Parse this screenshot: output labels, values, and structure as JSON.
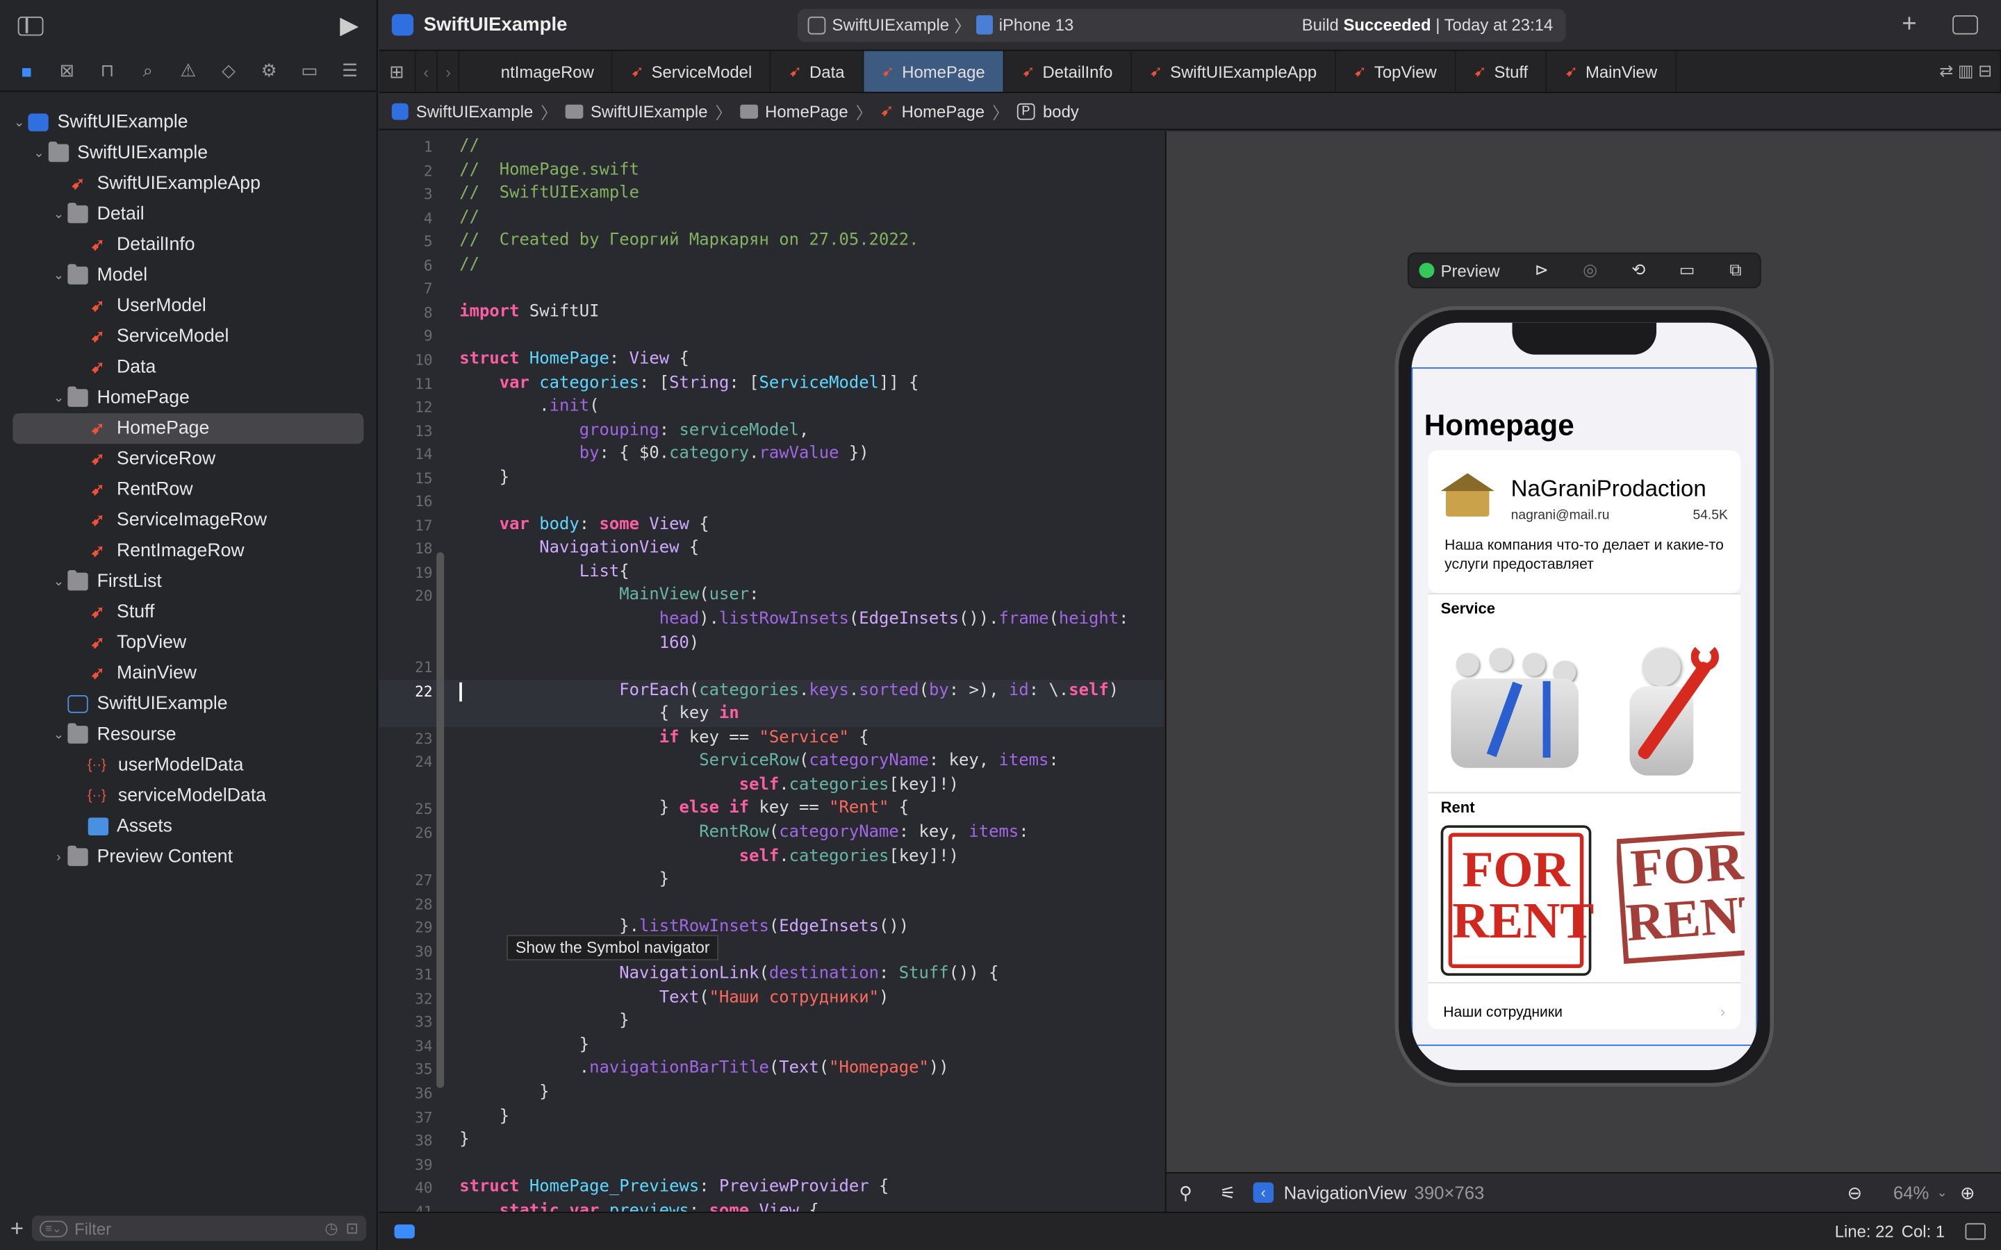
{
  "toolbar": {
    "project": "SwiftUIExample",
    "scheme": "SwiftUIExample",
    "device": "iPhone 13",
    "build_status_prefix": "Build ",
    "build_status": "Succeeded",
    "build_time": " | Today at 23:14"
  },
  "tabs": [
    "ntImageRow",
    "ServiceModel",
    "Data",
    "HomePage",
    "DetailInfo",
    "SwiftUIExampleApp",
    "TopView",
    "Stuff",
    "MainView"
  ],
  "active_tab": "HomePage",
  "breadcrumb": [
    "SwiftUIExample",
    "SwiftUIExample",
    "HomePage",
    "HomePage",
    "body"
  ],
  "navigator": [
    {
      "label": "SwiftUIExample",
      "kind": "project",
      "depth": 0,
      "open": true
    },
    {
      "label": "SwiftUIExample",
      "kind": "folder",
      "depth": 1,
      "open": true
    },
    {
      "label": "SwiftUIExampleApp",
      "kind": "swift",
      "depth": 2
    },
    {
      "label": "Detail",
      "kind": "folder",
      "depth": 2,
      "open": true
    },
    {
      "label": "DetailInfo",
      "kind": "swift",
      "depth": 3
    },
    {
      "label": "Model",
      "kind": "folder",
      "depth": 2,
      "open": true
    },
    {
      "label": "UserModel",
      "kind": "swift",
      "depth": 3
    },
    {
      "label": "ServiceModel",
      "kind": "swift",
      "depth": 3
    },
    {
      "label": "Data",
      "kind": "swift",
      "depth": 3
    },
    {
      "label": "HomePage",
      "kind": "folder",
      "depth": 2,
      "open": true
    },
    {
      "label": "HomePage",
      "kind": "swift",
      "depth": 3,
      "selected": true
    },
    {
      "label": "ServiceRow",
      "kind": "swift",
      "depth": 3
    },
    {
      "label": "RentRow",
      "kind": "swift",
      "depth": 3
    },
    {
      "label": "ServiceImageRow",
      "kind": "swift",
      "depth": 3
    },
    {
      "label": "RentImageRow",
      "kind": "swift",
      "depth": 3
    },
    {
      "label": "FirstList",
      "kind": "folder",
      "depth": 2,
      "open": true
    },
    {
      "label": "Stuff",
      "kind": "swift",
      "depth": 3
    },
    {
      "label": "TopView",
      "kind": "swift",
      "depth": 3
    },
    {
      "label": "MainView",
      "kind": "swift",
      "depth": 3
    },
    {
      "label": "SwiftUIExample",
      "kind": "entitlements",
      "depth": 2
    },
    {
      "label": "Resourse",
      "kind": "folder",
      "depth": 2,
      "open": true
    },
    {
      "label": "userModelData",
      "kind": "json",
      "depth": 3
    },
    {
      "label": "serviceModelData",
      "kind": "json",
      "depth": 3
    },
    {
      "label": "Assets",
      "kind": "assets",
      "depth": 3
    },
    {
      "label": "Preview Content",
      "kind": "folder",
      "depth": 2,
      "open": false
    }
  ],
  "filter_placeholder": "Filter",
  "code_lines": [
    {
      "n": "1",
      "h": "<span class='cm'>//</span>"
    },
    {
      "n": "2",
      "h": "<span class='cm'>//  HomePage.swift</span>"
    },
    {
      "n": "3",
      "h": "<span class='cm'>//  SwiftUIExample</span>"
    },
    {
      "n": "4",
      "h": "<span class='cm'>//</span>"
    },
    {
      "n": "5",
      "h": "<span class='cm'>//  Created by Георгий Маркарян on 27.05.2022.</span>"
    },
    {
      "n": "6",
      "h": "<span class='cm'>//</span>"
    },
    {
      "n": "7",
      "h": ""
    },
    {
      "n": "8",
      "h": "<span class='k'>import</span> SwiftUI"
    },
    {
      "n": "9",
      "h": ""
    },
    {
      "n": "10",
      "h": "<span class='k'>struct</span> <span class='t'>HomePage</span>: <span class='tp'>View</span> {"
    },
    {
      "n": "11",
      "h": "    <span class='k'>var</span> <span class='t'>categories</span>: [<span class='tp'>String</span>: [<span class='t'>ServiceModel</span>]] {"
    },
    {
      "n": "12",
      "h": "        .<span class='fn'>init</span>("
    },
    {
      "n": "13",
      "h": "            <span class='fn'>grouping</span>: <span class='f'>serviceModel</span>,"
    },
    {
      "n": "14",
      "h": "            <span class='fn'>by</span>: { $0.<span class='f'>category</span>.<span class='fn'>rawValue</span> })"
    },
    {
      "n": "15",
      "h": "    }"
    },
    {
      "n": "16",
      "h": ""
    },
    {
      "n": "17",
      "h": "    <span class='k'>var</span> <span class='t'>body</span>: <span class='k'>some</span> <span class='tp'>View</span> {"
    },
    {
      "n": "18",
      "h": "        <span class='tp'>NavigationView</span> {"
    },
    {
      "n": "19",
      "h": "            <span class='tp'>List</span>{"
    },
    {
      "n": "20",
      "h": "                <span class='f'>MainView</span>(<span class='f'>user</span>:"
    },
    {
      "n": "",
      "h": "                    <span class='fn'>head</span>).<span class='fn'>listRowInsets</span>(<span class='tp'>EdgeInsets</span>()).<span class='fn'>frame</span>(<span class='fn'>height</span>:"
    },
    {
      "n": "",
      "h": "                    <span class='tp'>160</span>)"
    },
    {
      "n": "21",
      "h": ""
    },
    {
      "n": "22",
      "h": "                <span class='tp'>ForEach</span>(<span class='f'>categories</span>.<span class='fn'>keys</span>.<span class='fn'>sorted</span>(<span class='fn'>by</span>: >), <span class='fn'>id</span>: \\.<span class='k'>self</span>)",
      "cur": true
    },
    {
      "n": "",
      "h": "                    { key <span class='k'>in</span>",
      "cur": true
    },
    {
      "n": "23",
      "h": "                    <span class='k'>if</span> key == <span class='s'>\"Service\"</span> {"
    },
    {
      "n": "24",
      "h": "                        <span class='f'>ServiceRow</span>(<span class='fn'>categoryName</span>: key, <span class='fn'>items</span>:"
    },
    {
      "n": "",
      "h": "                            <span class='k'>self</span>.<span class='f'>categories</span>[key]!)"
    },
    {
      "n": "25",
      "h": "                    } <span class='k'>else if</span> key == <span class='s'>\"Rent\"</span> {"
    },
    {
      "n": "26",
      "h": "                        <span class='f'>RentRow</span>(<span class='fn'>categoryName</span>: key, <span class='fn'>items</span>:"
    },
    {
      "n": "",
      "h": "                            <span class='k'>self</span>.<span class='f'>categories</span>[key]!)"
    },
    {
      "n": "27",
      "h": "                    }"
    },
    {
      "n": "28",
      "h": ""
    },
    {
      "n": "29",
      "h": "                }.<span class='fn'>listRowInsets</span>(<span class='tp'>EdgeInsets</span>())"
    },
    {
      "n": "30",
      "h": ""
    },
    {
      "n": "31",
      "h": "                <span class='tp'>NavigationLink</span>(<span class='fn'>destination</span>: <span class='f'>Stuff</span>()) {"
    },
    {
      "n": "32",
      "h": "                    <span class='tp'>Text</span>(<span class='s'>\"Наши сотрудники\"</span>)"
    },
    {
      "n": "33",
      "h": "                }"
    },
    {
      "n": "34",
      "h": "            }"
    },
    {
      "n": "35",
      "h": "            .<span class='fn'>navigationBarTitle</span>(<span class='tp'>Text</span>(<span class='s'>\"Homepage\"</span>))"
    },
    {
      "n": "36",
      "h": "        }"
    },
    {
      "n": "37",
      "h": "    }"
    },
    {
      "n": "38",
      "h": "}"
    },
    {
      "n": "39",
      "h": ""
    },
    {
      "n": "40",
      "h": "<span class='k'>struct</span> <span class='t'>HomePage_Previews</span>: <span class='tp'>PreviewProvider</span> {"
    },
    {
      "n": "41",
      "h": "    <span class='k'>static</span> <span class='k'>var</span> <span class='t'>previews</span>: <span class='k'>some</span> <span class='tp'>View</span> {"
    }
  ],
  "tooltip": "Show the Symbol navigator",
  "preview": {
    "label": "Preview",
    "nav_title": "Homepage",
    "company": "NaGraniProdaction",
    "email": "nagrani@mail.ru",
    "followers": "54.5K",
    "description": "Наша компания что-то делает и какие-то услуги предоставляет",
    "section_service": "Service",
    "section_rent": "Rent",
    "rent_word1": "FOR",
    "rent_word2": "RENT",
    "link": "Наши сотрудники"
  },
  "canvas_bottom": {
    "view": "NavigationView",
    "size": "390×763",
    "zoom": "64%"
  },
  "status": {
    "line": "Line: 22",
    "col": "Col: 1"
  },
  "colors": {
    "accent": "#3a8cff",
    "swift": "#f05138",
    "build_ok": "#ffffff",
    "tab_active": "#3d5a80",
    "rent_red": "#d0281e"
  }
}
